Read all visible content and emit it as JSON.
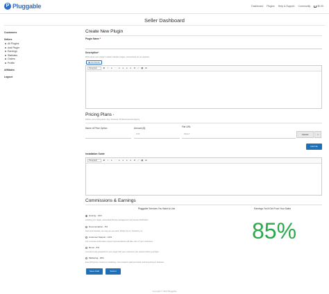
{
  "brand": {
    "name": "Pluggable",
    "mark": "P"
  },
  "nav": {
    "items": [
      "Dashboard",
      "Plugins",
      "Help & Support",
      "Community"
    ],
    "cart": "$0.00"
  },
  "page": {
    "title": "Seller Dashboard"
  },
  "sidebar": {
    "customers": "Customers",
    "sellers": "Sellers",
    "seller_items": [
      "All Plugins",
      "Add Plugin",
      "Earnings",
      "Statistics",
      "Orders",
      "Profile"
    ],
    "affiliates": "Affiliates",
    "logout": "Logout"
  },
  "form": {
    "heading": "Create New Plugin",
    "name_label": "Plugin Name",
    "required_mark": "*",
    "description_label": "Description",
    "description_hint": "Write about your plugin in detail. Include images, screenshots etc as required.",
    "add_media": "Add Media",
    "editor_format": "Paragraph",
    "editor_tools": [
      "B",
      "I",
      "≡",
      "“",
      "≡",
      "≡",
      "≡",
      "≡",
      "⊘",
      "⤢",
      "▦",
      "⊞"
    ]
  },
  "pricing": {
    "heading": "Pricing Plans",
    "heading_mark": "*",
    "hint": "Define your pricing plans. E.g. Personal, Professional and Agency.",
    "col_option": "Name of Price Option",
    "col_amount": "Amount ($)",
    "col_file": "File URL",
    "amount_value": "0.00",
    "file_placeholder": "https://",
    "upload": "Upload",
    "remove": "×",
    "add_file": "Add File"
  },
  "install": {
    "label": "Installation Guide",
    "editor_format": "Paragraph"
  },
  "commissions": {
    "heading": "Commissions & Earnings",
    "left_title": "Pluggable Services You Want to Use",
    "right_title": "Earnings You'll Get From Your Sales",
    "percent": "85%",
    "options": [
      {
        "label": "Hosting - 15%",
        "desc": "Hosting your plugin, automated license management and secure distribution.",
        "selected": true
      },
      {
        "label": "Documentation - 5%",
        "desc": "Docs and tutorials, as many as you want. Written by us, hosted by us.",
        "selected": false
      },
      {
        "label": "Customer Support - 10%",
        "desc": "Our in-house world-class support representatives will take care of your customers.",
        "selected": false
      },
      {
        "label": "Demo - 5%",
        "desc": "Live demo site prepared for your plugin that your customers can explore before purchase.",
        "selected": false
      },
      {
        "label": "Marketing - 20%",
        "desc": "Everything from content to marketing. Your reward is paid promotion and everything in between.",
        "selected": false
      }
    ],
    "save_draft": "Save Draft",
    "submit": "Submit"
  },
  "footer": {
    "text": "Copyright © 2015 Pluggable"
  },
  "colors": {
    "accent": "#1e6fb5",
    "percent": "#2aa84a"
  }
}
